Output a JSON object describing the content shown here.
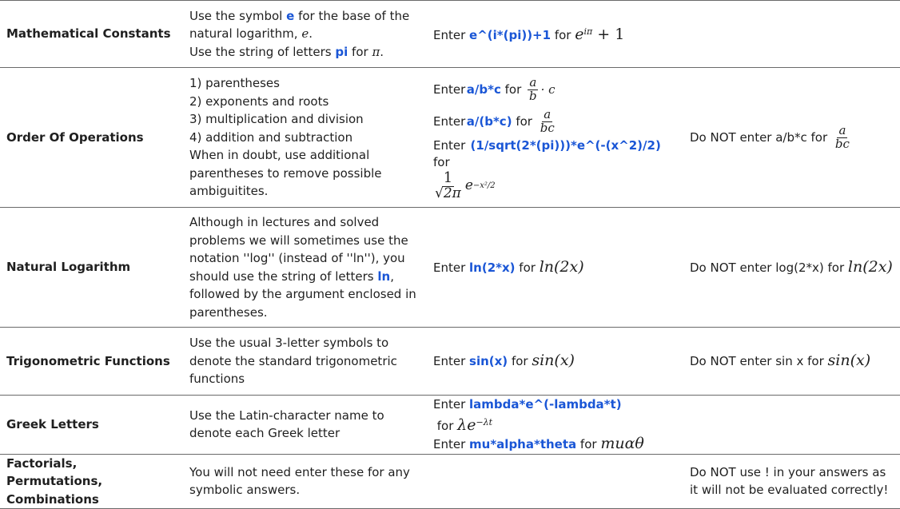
{
  "rows": [
    {
      "category": "Mathematical Constants",
      "description_lines": [
        {
          "pre": "Use the symbol ",
          "code": "e",
          "post": " for the base of the"
        },
        {
          "pre": "natural logarithm, ",
          "math": "e",
          "post": "."
        },
        {
          "pre": "Use the string of letters ",
          "code": "pi",
          "post": " for ",
          "math": "π",
          "post2": "."
        }
      ],
      "examples": [
        {
          "prefix": "Enter ",
          "code": "e^(i*(pi))+1",
          "for": " for ",
          "math": "e",
          "sup": "iπ",
          "tail": " + 1"
        }
      ],
      "warning": ""
    },
    {
      "category": "Order Of Operations",
      "description_lines": [
        "1) parentheses",
        "2) exponents and roots",
        "3) multiplication and division",
        "4) addition and subtraction",
        "When in doubt, use additional",
        "parentheses to remove possible",
        "ambiguitites."
      ],
      "examples": [
        {
          "prefix": "Enter ",
          "code": "a/b*c",
          "for": " for ",
          "num": "a",
          "den": "b",
          "tail": "· c"
        },
        {
          "prefix": "Enter ",
          "code": "a/(b*c)",
          "for": " for ",
          "num": "a",
          "den": "bc"
        },
        {
          "prefix": "Enter ",
          "code": "(1/sqrt(2*(pi)))*e^(-(x^2)/2)",
          "for": " for",
          "num": "1",
          "den": "√2π",
          "tail": "e",
          "sup": "−x²/2"
        }
      ],
      "warning": {
        "text": "Do NOT enter a/b*c for ",
        "num": "a",
        "den": "bc"
      }
    },
    {
      "category": "Natural Logarithm",
      "description_lines": [
        "Although in lectures and solved",
        "problems we will sometimes use the",
        "notation ''log'' (instead of ''ln''), you",
        {
          "pre": "should use the string of letters ",
          "code": "ln",
          "post": ","
        },
        "followed by the argument enclosed in",
        "parentheses."
      ],
      "examples": [
        {
          "prefix": "Enter ",
          "code": "ln(2*x)",
          "for": " for ",
          "math": "ln(2x)"
        }
      ],
      "warning": {
        "text": "Do NOT enter log(2*x) for ",
        "math": "ln(2x)"
      }
    },
    {
      "category": "Trigonometric Functions",
      "description_lines": [
        "Use the usual 3-letter symbols to",
        "denote the standard trigonometric",
        "functions"
      ],
      "examples": [
        {
          "prefix": "Enter ",
          "code": "sin(x)",
          "for": " for ",
          "math": "sin(x)"
        }
      ],
      "warning": {
        "text": "Do NOT enter sin x for ",
        "math": "sin(x)"
      }
    },
    {
      "category": "Greek Letters",
      "description_lines": [
        "Use the Latin-character name to",
        "denote each Greek letter"
      ],
      "examples": [
        {
          "prefix": "Enter ",
          "code": "lambda*e^(-lambda*t)",
          "for": " for ",
          "math": "λe",
          "sup": "−λt"
        },
        {
          "prefix": "Enter ",
          "code": "mu*alpha*theta",
          "for": " for ",
          "math": "muαθ"
        }
      ],
      "warning": ""
    },
    {
      "category": "Factorials, Permutations, Combinations",
      "description_lines": [
        "You will not need enter these for any",
        "symbolic answers."
      ],
      "examples": [],
      "warning": {
        "text": "Do NOT use ! in your answers as it will not be evaluated correctly!"
      }
    }
  ]
}
